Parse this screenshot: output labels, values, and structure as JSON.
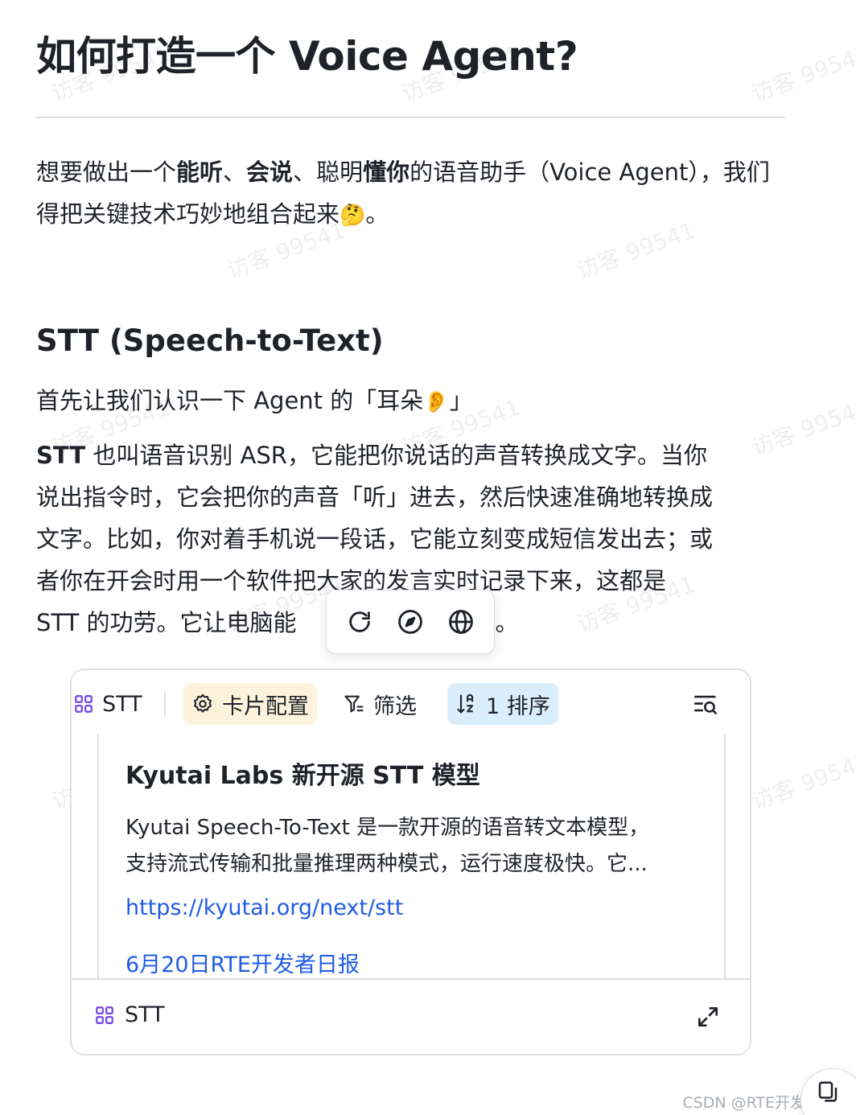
{
  "doc": {
    "title": "如何打造一个 Voice Agent?",
    "intro": {
      "p1": "想要做出一个",
      "b1": "能听",
      "p2": "、",
      "b2": "会说",
      "p3": "、聪明",
      "b3": "懂你",
      "p4": "的语音助手（Voice Agent），我们得把关键技术巧妙地组合起来",
      "emoji": "🤔",
      "p5": "。"
    },
    "section_heading": "STT (Speech-to-Text)",
    "lead": {
      "text": "首先让我们认识一下 Agent 的「耳朵",
      "emoji": "👂",
      "close": "」"
    },
    "body": {
      "bold": "STT",
      "line1": " 也叫语音识别 ASR，它能把你说话的声音转换成文字。当你",
      "line2": "说出指令时，它会把你的声音「听」进去，然后快速准确地转换成",
      "line3": "文字。比如，你对着手机说一段话，它能立刻变成短信发出去；或",
      "line4": "者你在开会时用一个软件把大家的发言实时记录下来，这都是",
      "line5_start": "STT 的功劳。它让电脑能",
      "line5_end": "话。"
    }
  },
  "floating_toolbar": {
    "icons": [
      "refresh-icon",
      "compass-icon",
      "globe-icon"
    ]
  },
  "card": {
    "toolbar": {
      "view_label": "STT",
      "config_label": "卡片配置",
      "filter_label": "筛选",
      "sort_label": "1 排序"
    },
    "record": {
      "title": "Kyutai Labs 新开源 STT 模型",
      "desc_line1": "Kyutai Speech-To-Text 是一款开源的语音转文本模型，",
      "desc_line2": "支持流式传输和批量推理两种模式，运行速度极快。它...",
      "link": "https://kyutai.org/next/stt",
      "source": "6月20日RTE开发者日报"
    },
    "footer": {
      "label": "STT"
    }
  },
  "watermark": "访客 99541",
  "credit": "CSDN @RTE开发者社区",
  "colors": {
    "text": "#1f2329",
    "link": "#1f5ce6",
    "config_bg": "#fdf3dc",
    "sort_bg": "#dbeefd",
    "grid_icon": "#7b4fe6",
    "border": "#dee0e3"
  }
}
